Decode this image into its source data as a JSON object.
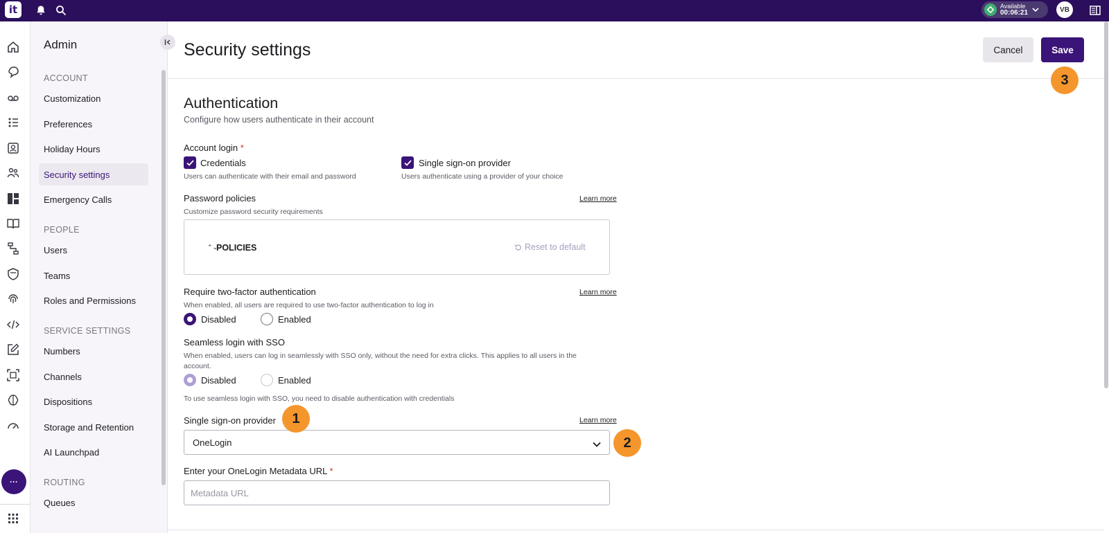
{
  "topbar": {
    "logo_text": "it",
    "status": {
      "label": "Available",
      "timer": "00:06:21",
      "color": "#3fae72"
    },
    "avatar_initials": "VB"
  },
  "sidebar": {
    "title": "Admin",
    "sections": [
      {
        "label": "ACCOUNT",
        "items": [
          "Customization",
          "Preferences",
          "Holiday Hours",
          "Security settings",
          "Emergency Calls"
        ]
      },
      {
        "label": "PEOPLE",
        "items": [
          "Users",
          "Teams",
          "Roles and Permissions"
        ]
      },
      {
        "label": "SERVICE SETTINGS",
        "items": [
          "Numbers",
          "Channels",
          "Dispositions",
          "Storage and Retention",
          "AI Launchpad"
        ]
      },
      {
        "label": "ROUTING",
        "items": [
          "Queues"
        ]
      }
    ],
    "active_item": "Security settings"
  },
  "rail": {
    "more_label": "···"
  },
  "header": {
    "title": "Security settings",
    "cancel_label": "Cancel",
    "save_label": "Save"
  },
  "auth": {
    "title": "Authentication",
    "subtitle": "Configure how users authenticate in their account",
    "account_login": {
      "label": "Account login",
      "required_mark": "*",
      "credentials": {
        "label": "Credentials",
        "checked": true,
        "help": "Users can authenticate with their email and password"
      },
      "sso": {
        "label": "Single sign-on provider",
        "checked": true,
        "help": "Users authenticate using a provider of your choice"
      }
    },
    "password_policies": {
      "label": "Password policies",
      "learn_more": "Learn more",
      "help": "Customize password security requirements",
      "policies_label": "POLICIES",
      "reset_label": "Reset to default"
    },
    "two_factor": {
      "label": "Require two-factor authentication",
      "learn_more": "Learn more",
      "help": "When enabled, all users are required to use two-factor authentication to log in",
      "options": [
        "Disabled",
        "Enabled"
      ],
      "selected": "Disabled"
    },
    "seamless": {
      "label": "Seamless login with SSO",
      "help_line1": "When enabled, users can log in seamlessly with SSO only, without the need for extra clicks. This applies to all users in the",
      "help_line2": "account.",
      "options": [
        "Disabled",
        "Enabled"
      ],
      "selected": "Disabled",
      "disabled_state": true,
      "note": "To use seamless login with SSO, you need to disable authentication with credentials"
    },
    "sso_provider": {
      "label": "Single sign-on provider",
      "learn_more": "Learn more",
      "value": "OneLogin"
    },
    "metadata_url": {
      "label": "Enter your OneLogin Metadata URL",
      "required_mark": "*",
      "placeholder": "Metadata URL"
    }
  },
  "annotations": {
    "badge_1": "1",
    "badge_2": "2",
    "badge_3": "3",
    "color": "#f4962c"
  }
}
